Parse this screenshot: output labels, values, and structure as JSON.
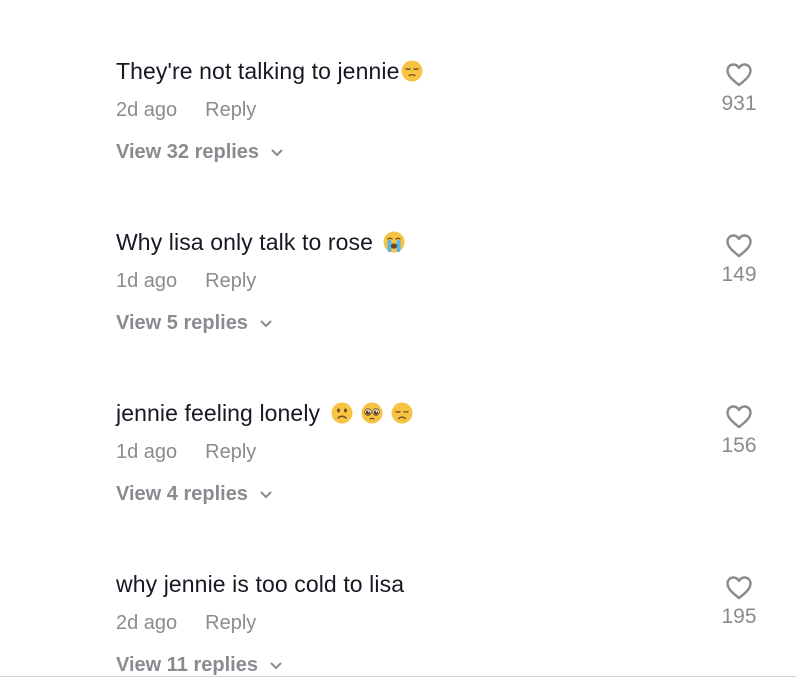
{
  "comments": [
    {
      "text": "They're not talking to jennie",
      "emojis": [
        "pensive-face"
      ],
      "time": "2d ago",
      "reply_label": "Reply",
      "view_replies": "View 32 replies",
      "likes": "931"
    },
    {
      "text": "Why lisa only talk to rose ",
      "emojis": [
        "loudly-crying-face"
      ],
      "time": "1d ago",
      "reply_label": "Reply",
      "view_replies": "View 5 replies",
      "likes": "149"
    },
    {
      "text": "jennie feeling lonely ",
      "emojis": [
        "slightly-frowning-face",
        "pleading-face",
        "disappointed-face"
      ],
      "time": "1d ago",
      "reply_label": "Reply",
      "view_replies": "View 4 replies",
      "likes": "156"
    },
    {
      "text": "why jennie is too cold to lisa",
      "emojis": [],
      "time": "2d ago",
      "reply_label": "Reply",
      "view_replies": "View 11 replies",
      "likes": "195"
    }
  ],
  "colors": {
    "text_primary": "#161823",
    "text_secondary": "#8a8b91",
    "emoji_yellow": "#f6c343"
  }
}
